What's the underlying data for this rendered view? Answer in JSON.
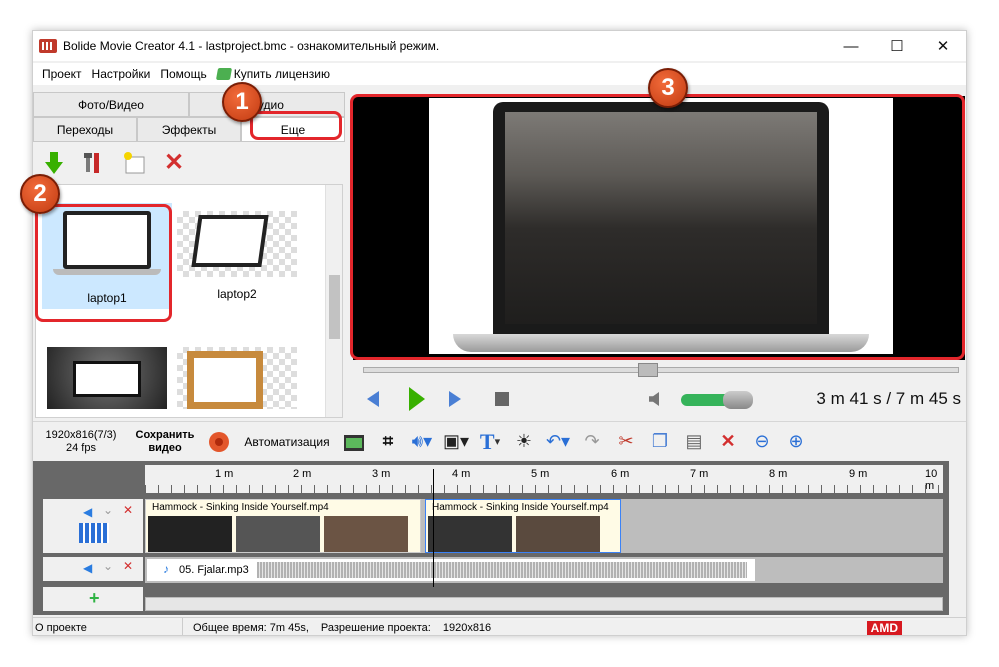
{
  "window": {
    "title": "Bolide Movie Creator 4.1 - lastproject.bmc  - ознакомительный режим.",
    "minimize": "—",
    "maximize": "☐",
    "close": "✕"
  },
  "menu": {
    "items": [
      "Проект",
      "Настройки",
      "Помощь"
    ],
    "buy_label": "Купить лицензию"
  },
  "tabs": {
    "row1": [
      "Фото/Видео",
      "Аудио"
    ],
    "row2": [
      "Переходы",
      "Эффекты",
      "Еще"
    ]
  },
  "gallery": {
    "items": [
      {
        "label": "laptop1",
        "selected": true
      },
      {
        "label": "laptop2",
        "selected": false
      },
      {
        "label": "",
        "selected": false
      },
      {
        "label": "",
        "selected": false
      }
    ]
  },
  "preview": {
    "time_current": "3 m 41 s",
    "time_total": "/ 7 m 45 s",
    "playback_fraction": 0.48,
    "volume_fraction": 0.62
  },
  "toolbar": {
    "resolution": "1920x816(7/3)",
    "fps": "24 fps",
    "save_line1": "Сохранить",
    "save_line2": "видео",
    "automation": "Автоматизация"
  },
  "timeline": {
    "ruler_labels": [
      "1 m",
      "2 m",
      "3 m",
      "4 m",
      "5 m",
      "6 m",
      "7 m",
      "8 m",
      "9 m",
      "10 m"
    ],
    "video_clips": [
      {
        "title": "Hammock - Sinking Inside Yourself.mp4"
      },
      {
        "title": "Hammock - Sinking Inside Yourself.mp4"
      }
    ],
    "audio_clip": "05. Fjalar.mp3"
  },
  "status": {
    "about": "О проекте",
    "total_time": "Общее время: 7m 45s,",
    "resolution_label": "Разрешение проекта:",
    "resolution_value": "1920x816",
    "brand": "AMD"
  },
  "annotations": [
    "1",
    "2",
    "3"
  ],
  "colors": {
    "callout": "#e3262b",
    "badge": "#d9531e",
    "selection": "#cce8ff",
    "play": "#38b000"
  }
}
